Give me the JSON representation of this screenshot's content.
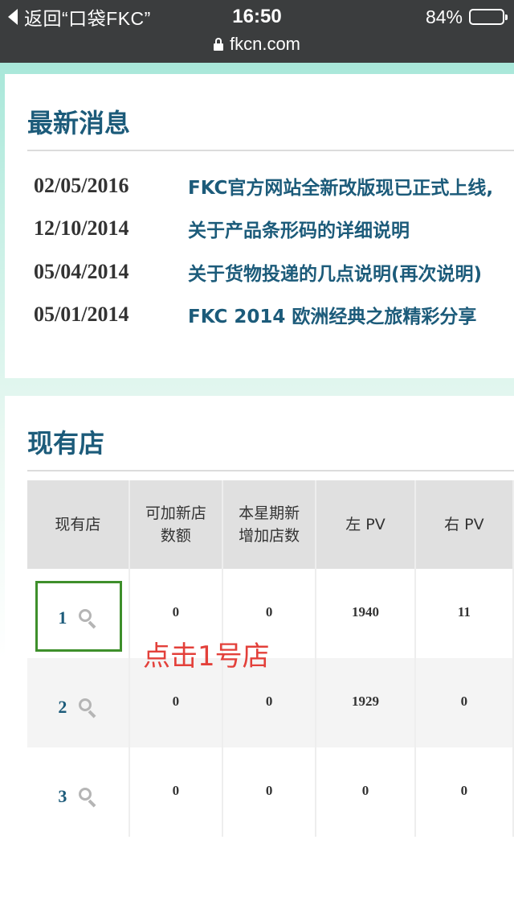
{
  "status": {
    "back_label": "返回“口袋FKC”",
    "time": "16:50",
    "battery": "84%",
    "battery_level": 0.84,
    "url": "fkcn.com"
  },
  "news": {
    "title": "最新消息",
    "items": [
      {
        "date": "02/05/2016",
        "text": "FKC官方网站全新改版现已正式上线,"
      },
      {
        "date": "12/10/2014",
        "text": "关于产品条形码的详细说明"
      },
      {
        "date": "05/04/2014",
        "text": "关于货物投递的几点说明(再次说明)"
      },
      {
        "date": "05/01/2014",
        "text": "FKC 2014 欧洲经典之旅精彩分享"
      }
    ]
  },
  "stores": {
    "title": "现有店",
    "headers": [
      "现有店",
      "可加新店\n数额",
      "本星期新\n增加店数",
      "左 PV",
      "右 PV"
    ],
    "rows": [
      {
        "store": "1",
        "can_add": "0",
        "new_this_week": "0",
        "left_pv": "1940",
        "right_pv": "11"
      },
      {
        "store": "2",
        "can_add": "0",
        "new_this_week": "0",
        "left_pv": "1929",
        "right_pv": "0"
      },
      {
        "store": "3",
        "can_add": "0",
        "new_this_week": "0",
        "left_pv": "0",
        "right_pv": "0"
      }
    ]
  },
  "annotation": "点击1号店",
  "colors": {
    "status_bar": "#3b3d3e",
    "heading": "#1c5b7a",
    "highlight_box": "#3e8f2b",
    "annotation": "#e3403a"
  }
}
